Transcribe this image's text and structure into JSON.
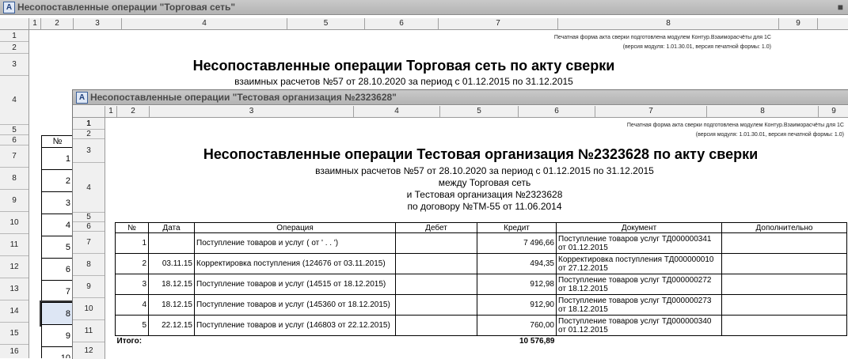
{
  "back_window": {
    "title": "Несопоставленные операции \"Торговая сеть\"",
    "close": "■",
    "columns": [
      "1",
      "2",
      "3",
      "4",
      "5",
      "6",
      "7",
      "8",
      "9"
    ],
    "rows": [
      "1",
      "2",
      "3",
      "4",
      "5",
      "6",
      "7",
      "8",
      "9",
      "10",
      "11",
      "12",
      "13",
      "14",
      "15",
      "16"
    ],
    "note_line1": "Печатная форма акта сверки подготовлена модулем Контур.Взаиморасчёты для 1С",
    "note_line2": "(версия модуля: 1.01.30.01, версия печатной формы: 1.0)",
    "heading": "Несопоставленные операции Торговая сеть по акту сверки",
    "subheading": "взаимных расчетов №57 от 28.10.2020 за период с 01.12.2015 по 31.12.2015",
    "num_header": "№",
    "nums": [
      "1",
      "2",
      "3",
      "4",
      "5",
      "6",
      "7",
      "8",
      "9",
      "10"
    ]
  },
  "front_window": {
    "title": "Несопоставленные операции \"Тестовая организация №2323628\"",
    "columns": [
      "1",
      "2",
      "3",
      "4",
      "5",
      "6",
      "7",
      "8",
      "9"
    ],
    "rows": [
      "1",
      "2",
      "3",
      "4",
      "5",
      "6",
      "7",
      "8",
      "9",
      "10",
      "11",
      "12"
    ],
    "note_line1": "Печатная форма акта сверки подготовлена модулем Контур.Взаиморасчёты для 1С",
    "note_line2": "(версия модуля: 1.01.30.01, версия печатной формы: 1.0)",
    "heading": "Несопоставленные операции Тестовая организация №2323628 по акту сверки",
    "sub1": "взаимных расчетов №57 от 28.10.2020 за период с 01.12.2015 по 31.12.2015",
    "sub2": "между Торговая сеть",
    "sub3": "и Тестовая организация №2323628",
    "sub4": "по договору №ТМ-55 от 11.06.2014",
    "table": {
      "headers": [
        "№",
        "Дата",
        "Операция",
        "Дебет",
        "Кредит",
        "Документ",
        "Дополнительно"
      ],
      "rows": [
        {
          "n": "1",
          "date": "",
          "op": "Поступление товаров и услуг ( от '   .   .   ')",
          "debit": "",
          "credit": "7 496,66",
          "doc": "Поступление товаров услуг ТД000000341 от 01.12.2015",
          "extra": ""
        },
        {
          "n": "2",
          "date": "03.11.15",
          "op": "Корректировка поступления (124676 от 03.11.2015)",
          "debit": "",
          "credit": "494,35",
          "doc": "Корректировка поступления ТД000000010 от 27.12.2015",
          "extra": ""
        },
        {
          "n": "3",
          "date": "18.12.15",
          "op": "Поступление товаров и услуг (14515 от 18.12.2015)",
          "debit": "",
          "credit": "912,98",
          "doc": "Поступление товаров услуг ТД000000272 от 18.12.2015",
          "extra": ""
        },
        {
          "n": "4",
          "date": "18.12.15",
          "op": "Поступление товаров и услуг (145360 от 18.12.2015)",
          "debit": "",
          "credit": "912,90",
          "doc": "Поступление товаров услуг ТД000000273 от 18.12.2015",
          "extra": ""
        },
        {
          "n": "5",
          "date": "22.12.15",
          "op": "Поступление товаров и услуг (146803 от 22.12.2015)",
          "debit": "",
          "credit": "760,00",
          "doc": "Поступление товаров услуг ТД000000340 от 01.12.2015",
          "extra": ""
        }
      ],
      "total_label": "Итого:",
      "total_value": "10 576,89"
    }
  }
}
